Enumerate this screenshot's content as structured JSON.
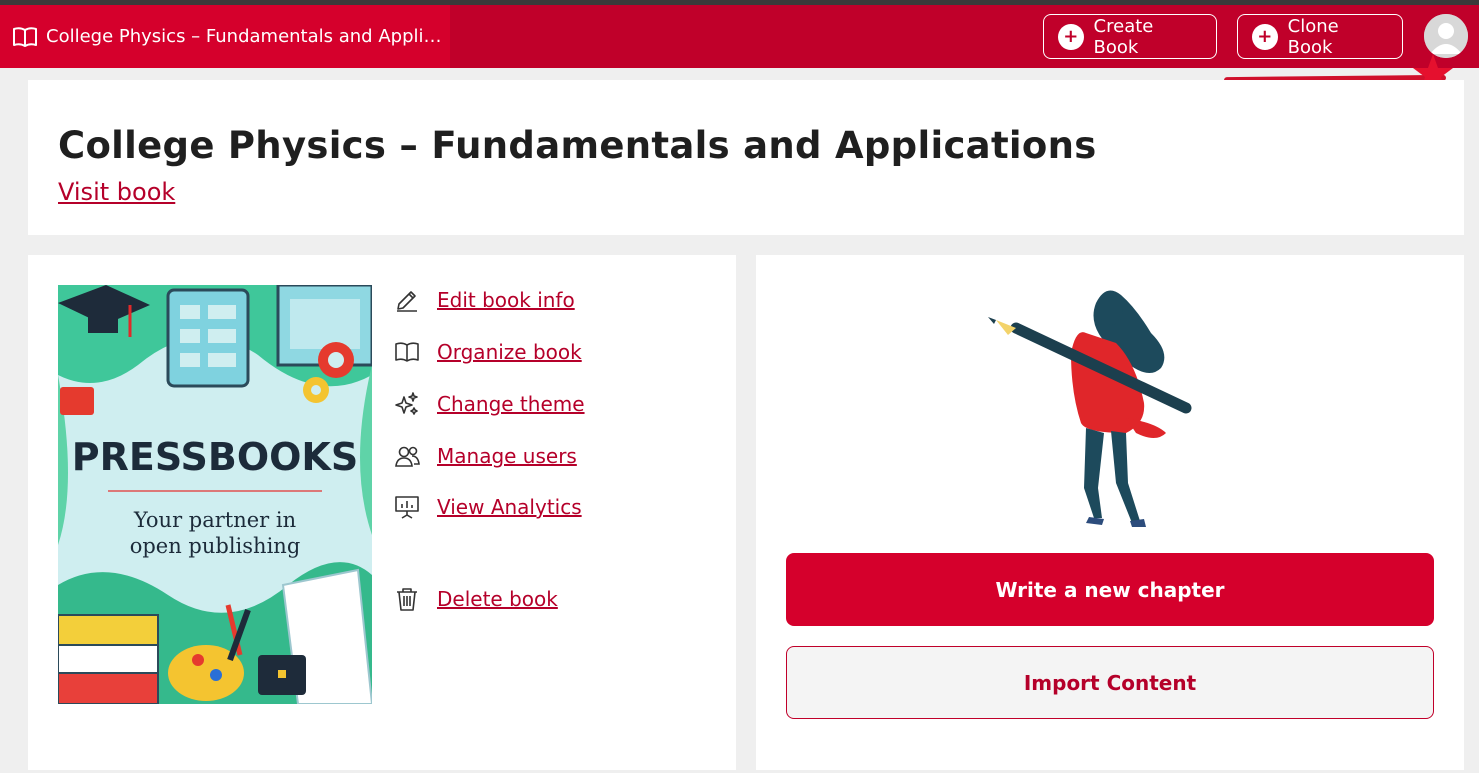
{
  "header": {
    "site_title": "College Physics – Fundamentals and Appli…",
    "create_book_label": "Create Book",
    "clone_book_label": "Clone Book"
  },
  "book": {
    "title": "College Physics – Fundamentals and Applications",
    "visit_label": "Visit book"
  },
  "cover": {
    "brand": "PRESSBOOKS",
    "tagline_line1": "Your partner in",
    "tagline_line2": "open publishing"
  },
  "actions": {
    "edit_info": "Edit book info",
    "organize": "Organize book",
    "change_theme": "Change theme",
    "manage_users": "Manage users",
    "view_analytics": "View Analytics",
    "delete": "Delete book"
  },
  "right_panel": {
    "write_chapter_label": "Write a new chapter",
    "import_content_label": "Import Content"
  },
  "colors": {
    "brand_red": "#c0002a",
    "link_red": "#b5002a",
    "button_red": "#d5002c"
  }
}
